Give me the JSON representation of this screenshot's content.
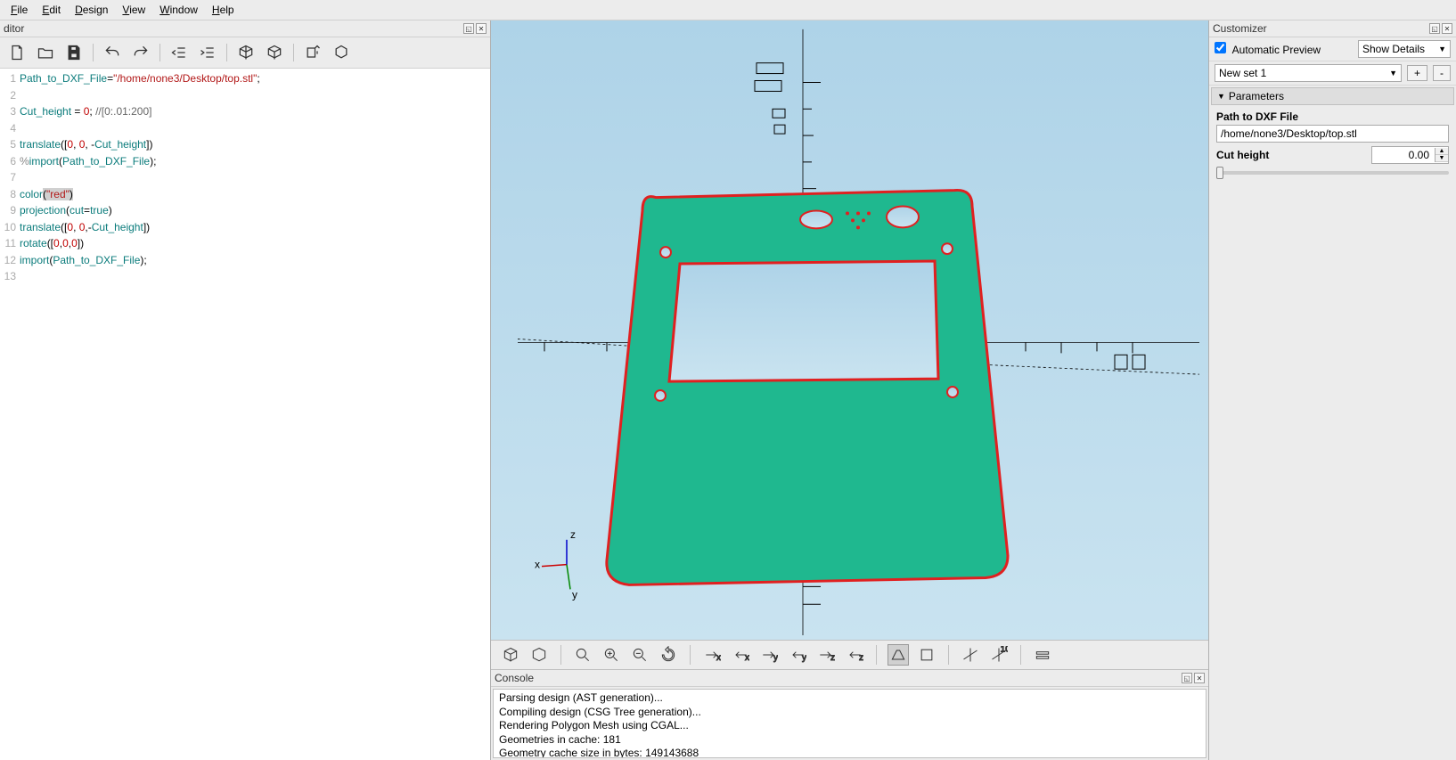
{
  "menubar": {
    "file": "File",
    "edit": "Edit",
    "design": "Design",
    "view": "View",
    "window": "Window",
    "help": "Help"
  },
  "editor": {
    "title": "ditor",
    "code": [
      {
        "n": 1,
        "html": "<span class='tok-id'>Path_to_DXF_File</span>=<span class='tok-str'>\"/home/none3/Desktop/top.stl\"</span>;"
      },
      {
        "n": 2,
        "html": ""
      },
      {
        "n": 3,
        "html": "<span class='tok-id'>Cut_height</span> = <span class='tok-num'>0</span>; <span class='tok-cmt'>//[0:.01:200]</span>"
      },
      {
        "n": 4,
        "html": ""
      },
      {
        "n": 5,
        "html": "<span class='tok-kw'>translate</span>([<span class='tok-num'>0</span>, <span class='tok-num'>0</span>, -<span class='tok-id'>Cut_height</span>])"
      },
      {
        "n": 6,
        "html": "<span class='tok-mod'>%</span><span class='tok-kw'>import</span>(<span class='tok-id'>Path_to_DXF_File</span>);"
      },
      {
        "n": 7,
        "html": ""
      },
      {
        "n": 8,
        "html": "<span class='tok-kw'>color</span><span style='background:#d0d0d0'>(<span class='tok-str'>\"red\"</span>)</span>"
      },
      {
        "n": 9,
        "html": "<span class='tok-kw'>projection</span>(<span class='tok-id'>cut</span>=<span class='tok-kw'>true</span>)"
      },
      {
        "n": 10,
        "html": "<span class='tok-kw'>translate</span>([<span class='tok-num'>0</span>, <span class='tok-num'>0</span>,-<span class='tok-id'>Cut_height</span>])"
      },
      {
        "n": 11,
        "html": "<span class='tok-kw'>rotate</span>([<span class='tok-num'>0</span>,<span class='tok-num'>0</span>,<span class='tok-num'>0</span>])"
      },
      {
        "n": 12,
        "html": "<span class='tok-kw'>import</span>(<span class='tok-id'>Path_to_DXF_File</span>);"
      },
      {
        "n": 13,
        "html": ""
      }
    ]
  },
  "viewport": {
    "axes": {
      "x": "x",
      "y": "y",
      "z": "z"
    }
  },
  "console": {
    "title": "Console",
    "lines": [
      "Parsing design (AST generation)...",
      "Compiling design (CSG Tree generation)...",
      "Rendering Polygon Mesh using CGAL...",
      "Geometries in cache: 181",
      "Geometry cache size in bytes: 149143688"
    ]
  },
  "customizer": {
    "title": "Customizer",
    "auto_preview": "Automatic Preview",
    "show_details": "Show Details",
    "set_name": "New set 1",
    "btn_plus": "+",
    "btn_minus": "-",
    "parameters_hdr": "Parameters",
    "path_label": "Path to DXF File",
    "path_value": "/home/none3/Desktop/top.stl",
    "cut_label": "Cut height",
    "cut_value": "0.00"
  }
}
